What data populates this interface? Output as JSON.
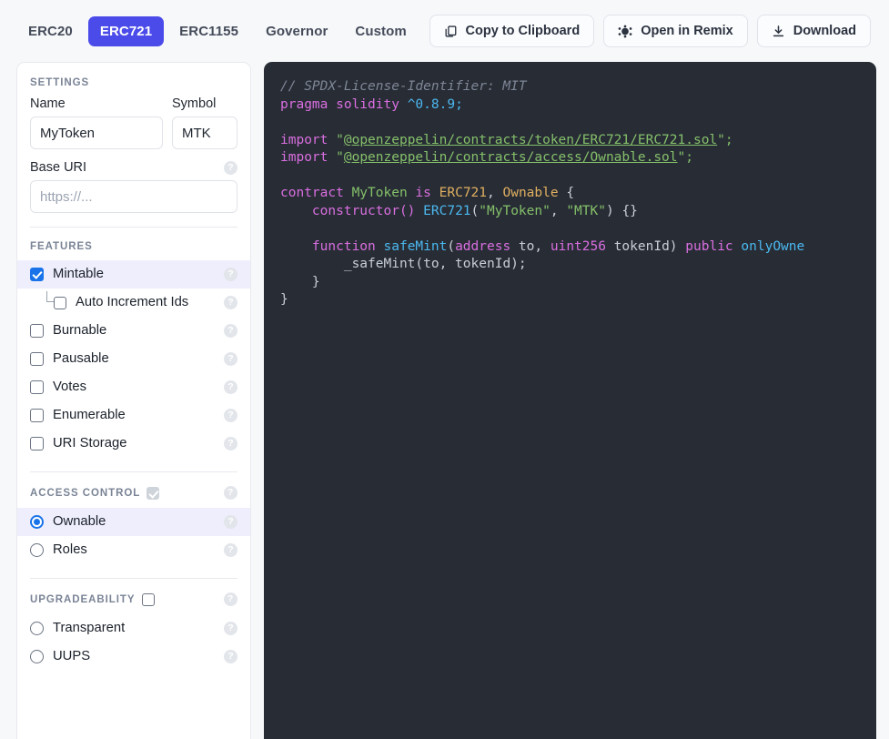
{
  "header": {
    "tabs": [
      {
        "label": "ERC20",
        "active": false
      },
      {
        "label": "ERC721",
        "active": true
      },
      {
        "label": "ERC1155",
        "active": false
      },
      {
        "label": "Governor",
        "active": false
      },
      {
        "label": "Custom",
        "active": false
      }
    ],
    "actions": [
      {
        "label": "Copy to Clipboard",
        "icon": "copy-icon"
      },
      {
        "label": "Open in Remix",
        "icon": "remix-icon"
      },
      {
        "label": "Download",
        "icon": "download-icon"
      }
    ]
  },
  "sidebar": {
    "settings": {
      "title": "SETTINGS",
      "name_label": "Name",
      "name_value": "MyToken",
      "symbol_label": "Symbol",
      "symbol_value": "MTK",
      "baseuri_label": "Base URI",
      "baseuri_value": "",
      "baseuri_placeholder": "https://...",
      "help": "?"
    },
    "features": {
      "title": "FEATURES",
      "items": [
        {
          "label": "Mintable",
          "checked": true,
          "nested": false,
          "selected": true
        },
        {
          "label": "Auto Increment Ids",
          "checked": false,
          "nested": true,
          "selected": false
        },
        {
          "label": "Burnable",
          "checked": false,
          "nested": false,
          "selected": false
        },
        {
          "label": "Pausable",
          "checked": false,
          "nested": false,
          "selected": false
        },
        {
          "label": "Votes",
          "checked": false,
          "nested": false,
          "selected": false
        },
        {
          "label": "Enumerable",
          "checked": false,
          "nested": false,
          "selected": false
        },
        {
          "label": "URI Storage",
          "checked": false,
          "nested": false,
          "selected": false
        }
      ]
    },
    "access_control": {
      "title": "ACCESS CONTROL",
      "toggle_checked": true,
      "toggle_disabled": true,
      "items": [
        {
          "label": "Ownable",
          "selected": true
        },
        {
          "label": "Roles",
          "selected": false
        }
      ]
    },
    "upgradeability": {
      "title": "UPGRADEABILITY",
      "toggle_checked": false,
      "items": [
        {
          "label": "Transparent",
          "selected": false
        },
        {
          "label": "UUPS",
          "selected": false
        }
      ]
    }
  },
  "code": {
    "language": "solidity",
    "license_comment": "// SPDX-License-Identifier: MIT",
    "pragma_keyword": "pragma solidity",
    "pragma_version": "^0.8.9;",
    "import_keyword": "import",
    "import_1": "@openzeppelin/contracts/token/ERC721/ERC721.sol",
    "import_2": "@openzeppelin/contracts/access/Ownable.sol",
    "contract_keyword": "contract",
    "contract_name": "MyToken",
    "is_keyword": "is",
    "base_1": "ERC721",
    "base_2": "Ownable",
    "constructor_kw": "constructor()",
    "constructor_base": "ERC721",
    "constructor_arg_name": "\"MyToken\"",
    "constructor_arg_symbol": "\"MTK\"",
    "function_kw": "function",
    "function_name": "safeMint",
    "param_type_1": "address",
    "param_name_1": "to,",
    "param_type_2": "uint256",
    "param_name_2": "tokenId)",
    "visibility": "public",
    "modifier": "onlyOwne",
    "body_call": "_safeMint(to, tokenId);"
  }
}
